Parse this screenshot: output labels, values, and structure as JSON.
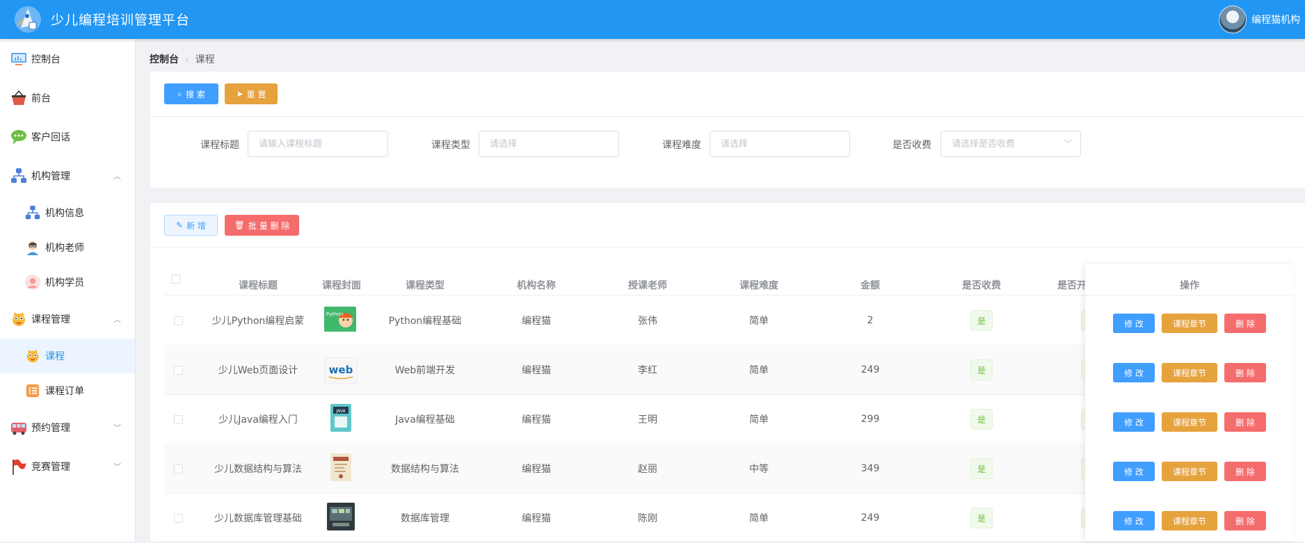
{
  "header": {
    "app_title": "少儿编程培训管理平台",
    "user_name": "编程猫机构"
  },
  "sidebar": {
    "items": [
      {
        "label": "控制台",
        "icon": "monitor-icon"
      },
      {
        "label": "前台",
        "icon": "basket-icon"
      },
      {
        "label": "客户回话",
        "icon": "chat-icon"
      },
      {
        "label": "机构管理",
        "icon": "org-chart-icon",
        "arrow": "up"
      },
      {
        "label": "课程管理",
        "icon": "mascot-icon",
        "arrow": "up"
      },
      {
        "label": "预约管理",
        "icon": "bus-icon",
        "arrow": "down"
      },
      {
        "label": "竞赛管理",
        "icon": "flag-icon",
        "arrow": "down"
      }
    ],
    "org_sub": [
      {
        "label": "机构信息",
        "icon": "org-chart-icon"
      },
      {
        "label": "机构老师",
        "icon": "teacher-icon"
      },
      {
        "label": "机构学员",
        "icon": "student-icon"
      }
    ],
    "course_sub": [
      {
        "label": "课程",
        "icon": "mascot-icon",
        "active": true
      },
      {
        "label": "课程订单",
        "icon": "order-icon"
      }
    ]
  },
  "breadcrumb": {
    "root": "控制台",
    "current": "课程"
  },
  "search": {
    "search_btn": "搜 索",
    "reset_btn": "重 置",
    "fields": [
      {
        "label": "课程标题",
        "placeholder": "请输入课程标题"
      },
      {
        "label": "课程类型",
        "placeholder": "请选择"
      },
      {
        "label": "课程难度",
        "placeholder": "请选择"
      },
      {
        "label": "是否收费",
        "placeholder": "请选择是否收费"
      }
    ]
  },
  "toolbar": {
    "add_btn": "新 增",
    "batch_delete_btn": "批 量 删 除"
  },
  "table": {
    "headers": [
      "课程标题",
      "课程封面",
      "课程类型",
      "机构名称",
      "授课老师",
      "课程难度",
      "金额",
      "是否收费",
      "是否开",
      "操作"
    ],
    "rows": [
      {
        "title": "少儿Python编程启蒙",
        "cover": "Python",
        "type": "Python编程基础",
        "org": "编程猫",
        "teacher": "张伟",
        "level": "简单",
        "price": "2",
        "paid": "是"
      },
      {
        "title": "少儿Web页面设计",
        "cover": "web",
        "type": "Web前端开发",
        "org": "编程猫",
        "teacher": "李红",
        "level": "简单",
        "price": "249",
        "paid": "是"
      },
      {
        "title": "少儿Java编程入门",
        "cover": "JAVA",
        "type": "Java编程基础",
        "org": "编程猫",
        "teacher": "王明",
        "level": "简单",
        "price": "299",
        "paid": "是"
      },
      {
        "title": "少儿数据结构与算法",
        "cover": "",
        "type": "数据结构与算法",
        "org": "编程猫",
        "teacher": "赵丽",
        "level": "中等",
        "price": "349",
        "paid": "是"
      },
      {
        "title": "少儿数据库管理基础",
        "cover": "",
        "type": "数据库管理",
        "org": "编程猫",
        "teacher": "陈刚",
        "level": "简单",
        "price": "249",
        "paid": "是"
      }
    ],
    "actions": {
      "edit": "修 改",
      "chapters": "课程章节",
      "delete": "删 除"
    }
  },
  "colors": {
    "primary": "#2196f3",
    "blue": "#409eff",
    "orange": "#e6a23c",
    "red": "#f56c6c",
    "green": "#67c23a"
  }
}
